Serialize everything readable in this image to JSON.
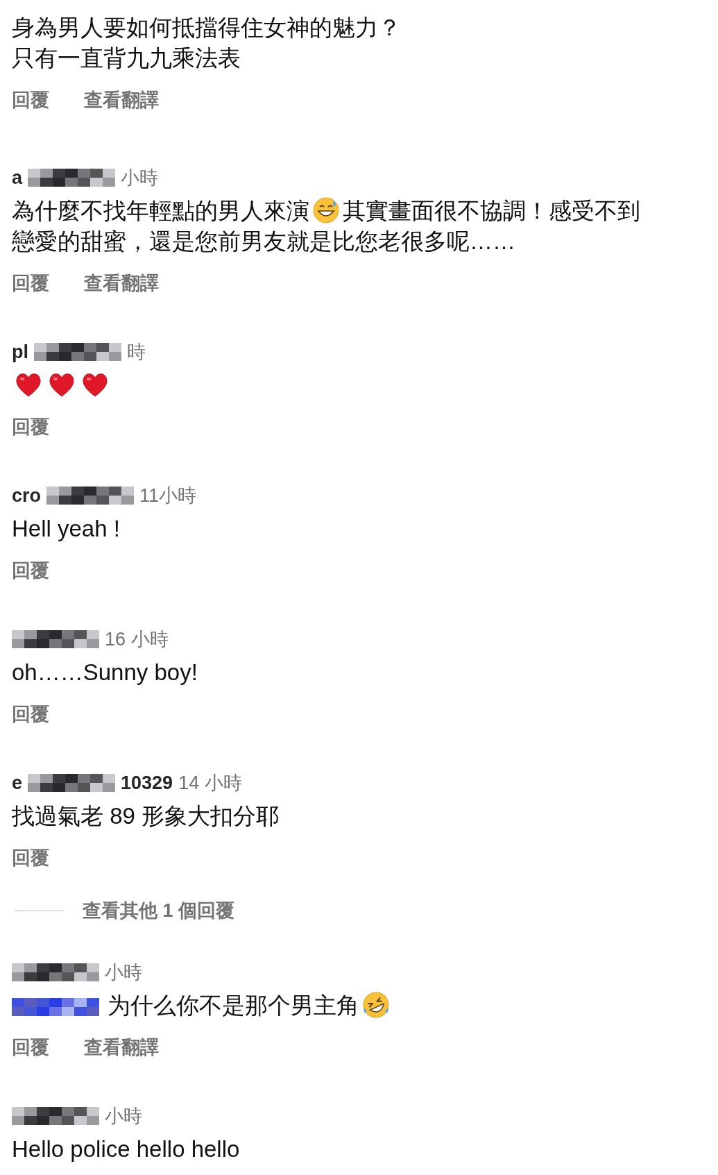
{
  "comments": [
    {
      "body": [
        {
          "kind": "text",
          "text": "身為男人要如何抵擋得住女神的魅力？"
        },
        {
          "kind": "break"
        },
        {
          "kind": "text",
          "text": "只有一直背九九乘法表"
        }
      ],
      "actions": [
        "回覆",
        "查看翻譯"
      ]
    },
    {
      "header": [
        {
          "kind": "name",
          "text": "a"
        },
        {
          "kind": "mosaic"
        },
        {
          "kind": "time",
          "text": "小時"
        }
      ],
      "body": [
        {
          "kind": "text",
          "text": "為什麼不找年輕點的男人來演"
        },
        {
          "kind": "sweat-smile"
        },
        {
          "kind": "text",
          "text": "其實畫面很不協調！感受不到"
        },
        {
          "kind": "break"
        },
        {
          "kind": "text",
          "text": "戀愛的甜蜜，還是您前男友就是比您老很多呢……"
        }
      ],
      "actions": [
        "回覆",
        "查看翻譯"
      ]
    },
    {
      "header": [
        {
          "kind": "name",
          "text": "pl"
        },
        {
          "kind": "mosaic"
        },
        {
          "kind": "time",
          "text": "時"
        }
      ],
      "body": [
        {
          "kind": "heart"
        },
        {
          "kind": "heart"
        },
        {
          "kind": "heart"
        }
      ],
      "actions": [
        "回覆"
      ]
    },
    {
      "header": [
        {
          "kind": "name",
          "text": "cro"
        },
        {
          "kind": "mosaic"
        },
        {
          "kind": "time",
          "text": "11小時"
        }
      ],
      "body": [
        {
          "kind": "text",
          "text": "Hell yeah !"
        }
      ],
      "actions": [
        "回覆"
      ]
    },
    {
      "header": [
        {
          "kind": "mosaic"
        },
        {
          "kind": "time",
          "text": "16 小時"
        }
      ],
      "body": [
        {
          "kind": "text",
          "text": "oh……Sunny boy!"
        }
      ],
      "actions": [
        "回覆"
      ]
    },
    {
      "header": [
        {
          "kind": "name",
          "text": "e"
        },
        {
          "kind": "mosaic"
        },
        {
          "kind": "name",
          "text": "10329"
        },
        {
          "kind": "time",
          "text": "14 小時"
        }
      ],
      "body": [
        {
          "kind": "text",
          "text": "找過氣老 89 形象大扣分耶"
        }
      ],
      "actions": [
        "回覆"
      ],
      "more_replies": "查看其他 1 個回覆"
    },
    {
      "header": [
        {
          "kind": "mosaic"
        },
        {
          "kind": "time",
          "text": "小時"
        }
      ],
      "body": [
        {
          "kind": "mention-mosaic"
        },
        {
          "kind": "text",
          "text": "为什么你不是那个男主角"
        },
        {
          "kind": "rofl"
        }
      ],
      "actions": [
        "回覆",
        "查看翻譯"
      ]
    },
    {
      "header": [
        {
          "kind": "mosaic"
        },
        {
          "kind": "time",
          "text": "小時"
        }
      ],
      "body": [
        {
          "kind": "text",
          "text": "Hello police hello hello"
        }
      ]
    }
  ]
}
